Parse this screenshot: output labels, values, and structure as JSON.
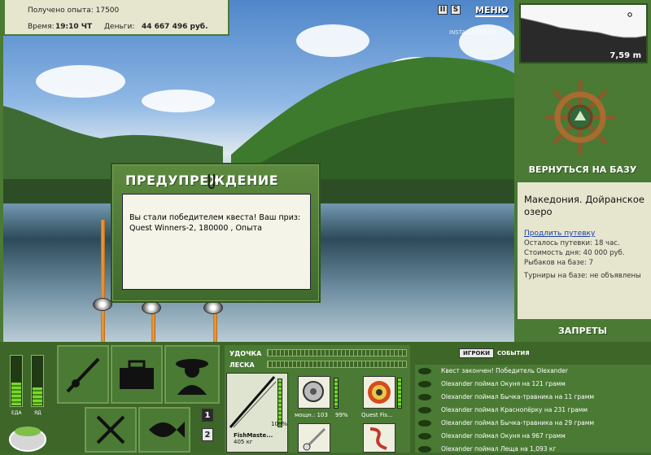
{
  "stats": {
    "experience_label": "Получено опыта:",
    "experience_value": "17500",
    "time_label": "Время:",
    "time_value": "19:10 ЧТ",
    "money_label": "Деньги:",
    "money_value": "44 667 496 руб."
  },
  "top": {
    "pause_glyph": "II",
    "sound_glyph": "S",
    "menu_label": "МЕНЮ",
    "watermark": "INSTALLSOFT.RU"
  },
  "depth": {
    "value": "7,59 m"
  },
  "dialog": {
    "title": "ПРЕДУПРЕЖДЕНИЕ",
    "message": "Вы стали победителем квеста! Ваш приз: Quest Winners-2, 180000 , Опыта"
  },
  "right": {
    "return_label": "ВЕРНУТЬСЯ НА БАЗУ",
    "location": "Македония. Дойранское озеро",
    "extend_link": "Продлить путевку",
    "trip_left": "Осталось путевки: 18 час.",
    "day_cost": "Стоимость дня: 40 000 руб.",
    "fishers": "Рыбаков на базе: 7",
    "tournaments": "Турниры на базе: не объявлены",
    "bans_label": "ЗАПРЕТЫ"
  },
  "gauges": {
    "food_label": "ЕДА",
    "poison_label": "ЯД",
    "food_level": 0.45,
    "poison_level": 0.35
  },
  "pages": [
    "1",
    "2"
  ],
  "gear": {
    "rod_label": "УДОЧКА",
    "line_label": "ЛЕСКА",
    "rod_name": "FishMaste...",
    "rod_weight": "405 кг",
    "rod_percent": "100%",
    "reel_power": "мощн.: 103",
    "reel_percent": "99%",
    "line_name": "Quest Fis..."
  },
  "chat": {
    "tabs": [
      "ИГРОКИ",
      "СОБЫТИЯ"
    ],
    "messages": [
      "Квест закончен! Победитель Olexander",
      "Olexander поймал Окуня на 121 грамм",
      "Olexander поймал Бычка-травника на 11 грамм",
      "Olexander поймал Краснопёрку на 231 грамм",
      "Olexander поймал Бычка-травника на 29 грамм",
      "Olexander поймал Окуня на 967 грамм",
      "Olexander поймал Леща на 1,093 кг"
    ]
  },
  "colors": {
    "panel_green": "#4a7a33",
    "dark_green": "#3d6628",
    "paper": "#e6e6cf",
    "link_blue": "#1a3faa"
  }
}
